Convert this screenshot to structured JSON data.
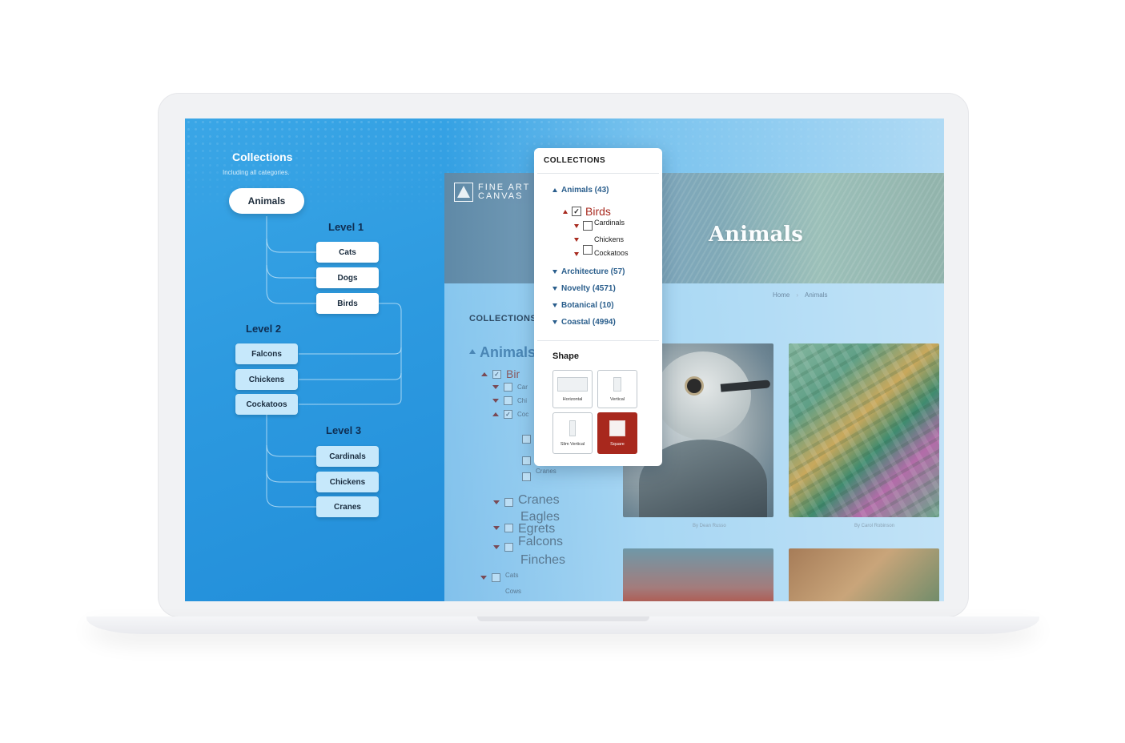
{
  "diagram": {
    "title": "Collections",
    "subtitle": "Including all categories.",
    "root": "Animals",
    "level1": {
      "label": "Level 1",
      "items": [
        "Cats",
        "Dogs",
        "Birds"
      ]
    },
    "level2": {
      "label": "Level 2",
      "items": [
        "Falcons",
        "Chickens",
        "Cockatoos"
      ]
    },
    "level3": {
      "label": "Level 3",
      "items": [
        "Cardinals",
        "Chickens",
        "Cranes"
      ]
    }
  },
  "site": {
    "logo_line1": "FINE ART",
    "logo_line2": "CANVAS",
    "hero_title": "Animals",
    "breadcrumb": {
      "home": "Home",
      "current": "Animals"
    },
    "collections_heading": "COLLECTIONS",
    "sidebar_title": "Animals",
    "tree": {
      "birds": "Bir",
      "car": "Car",
      "chi": "Chi",
      "coc": "Coc",
      "cranes_sub": "Cranes",
      "cranes": "Cranes",
      "eagles": "Eagles",
      "egrets": "Egrets",
      "falcons": "Falcons",
      "finches": "Finches",
      "cats": "Cats",
      "cows": "Cows"
    },
    "credits": [
      "By Dean Russo",
      "By Carol Robinson"
    ]
  },
  "popover": {
    "heading": "COLLECTIONS",
    "animals": "Animals (43)",
    "birds": "Birds",
    "birds_children": [
      "Cardinals",
      "Chickens",
      "Cockatoos"
    ],
    "categories": [
      "Architecture (57)",
      "Novelty (4571)",
      "Botanical (10)",
      "Coastal (4994)"
    ],
    "shape_title": "Shape",
    "shapes": [
      "Horizontal",
      "Vertical",
      "Slim Vertical",
      "Square"
    ],
    "selected_shape": "Square",
    "accent_color": "#a8281d",
    "link_color": "#2a5e8c"
  }
}
